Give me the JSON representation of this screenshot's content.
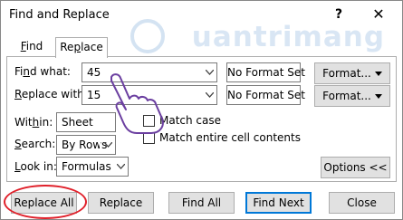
{
  "window": {
    "title": "Find and Replace",
    "help": "?",
    "close": "✕"
  },
  "tabs": [
    {
      "label": "Find"
    },
    {
      "label": "Replace"
    }
  ],
  "find_what": {
    "label": "Find what:",
    "value": "45",
    "format_status": "No Format Set",
    "format_button": "Format..."
  },
  "replace_with": {
    "label": "Replace with:",
    "value": "15",
    "format_status": "No Format Set",
    "format_button": "Format..."
  },
  "within": {
    "label": "Within:",
    "value": "Sheet"
  },
  "search": {
    "label": "Search:",
    "value": "By Rows"
  },
  "look_in": {
    "label": "Look in:",
    "value": "Formulas"
  },
  "options": {
    "match_case": {
      "label": "Match case",
      "checked": false
    },
    "match_entire": {
      "label": "Match entire cell contents",
      "checked": false
    },
    "options_button": "Options <<"
  },
  "footer": {
    "replace_all": "Replace All",
    "replace": "Replace",
    "find_all": "Find All",
    "find_next": "Find Next",
    "close": "Close"
  },
  "watermark": "uantrimang",
  "colors": {
    "highlight_circle": "#e0202a",
    "watermark": "#aac8e6"
  }
}
